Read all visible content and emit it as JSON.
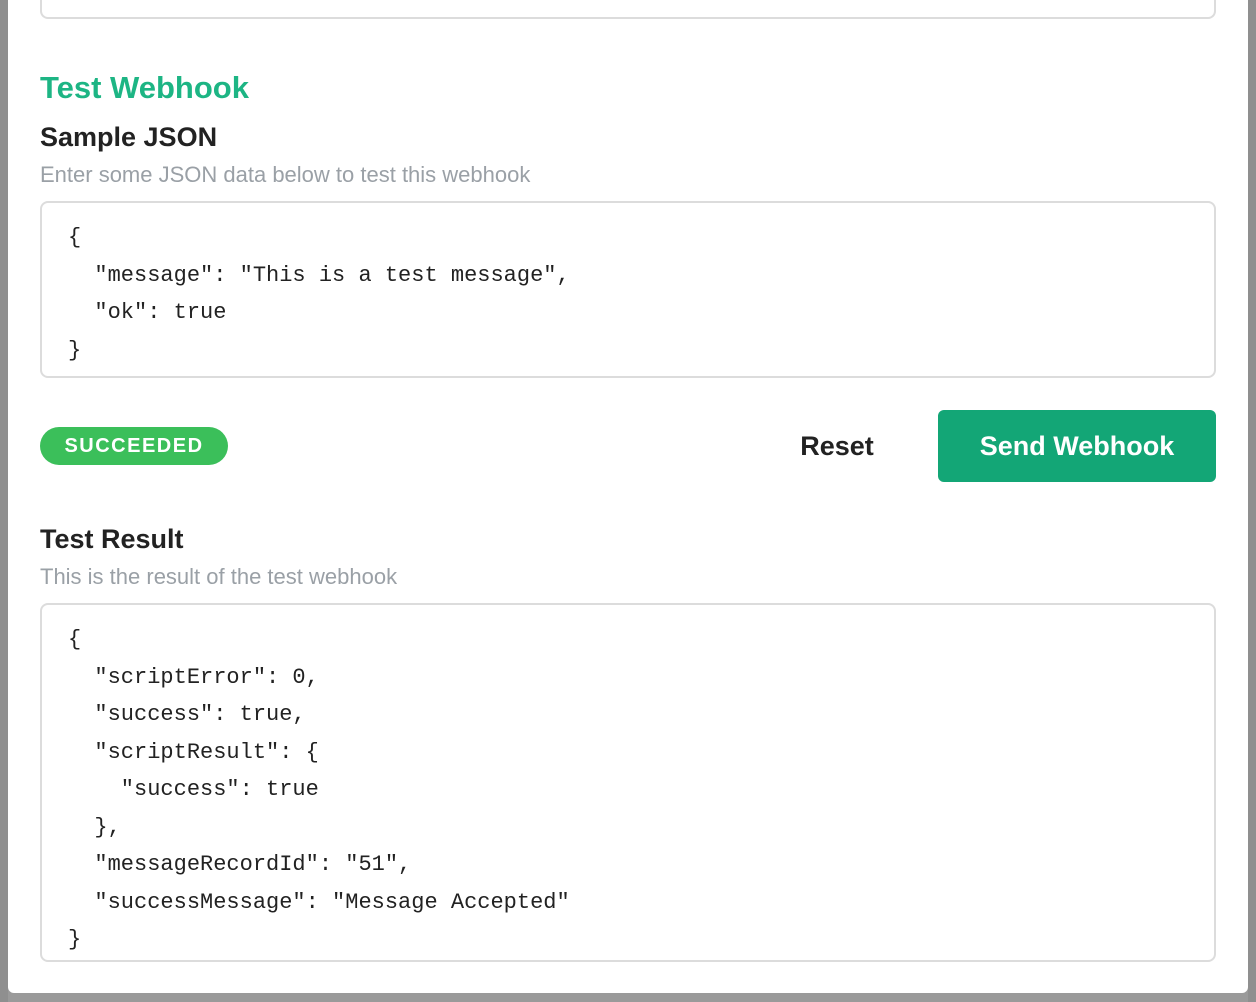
{
  "section": {
    "title": "Test Webhook"
  },
  "sample": {
    "label": "Sample JSON",
    "help": "Enter some JSON data below to test this webhook",
    "value": "{\n  \"message\": \"This is a test message\",\n  \"ok\": true\n}"
  },
  "actions": {
    "status": "SUCCEEDED",
    "reset_label": "Reset",
    "send_label": "Send Webhook"
  },
  "result": {
    "label": "Test Result",
    "help": "This is the result of the test webhook",
    "value": "{\n  \"scriptError\": 0,\n  \"success\": true,\n  \"scriptResult\": {\n    \"success\": true\n  },\n  \"messageRecordId\": \"51\",\n  \"successMessage\": \"Message Accepted\"\n}"
  },
  "colors": {
    "accent": "#1db584",
    "button": "#13a676",
    "success_badge": "#3bbf5a",
    "muted_text": "#9aa0a6"
  }
}
